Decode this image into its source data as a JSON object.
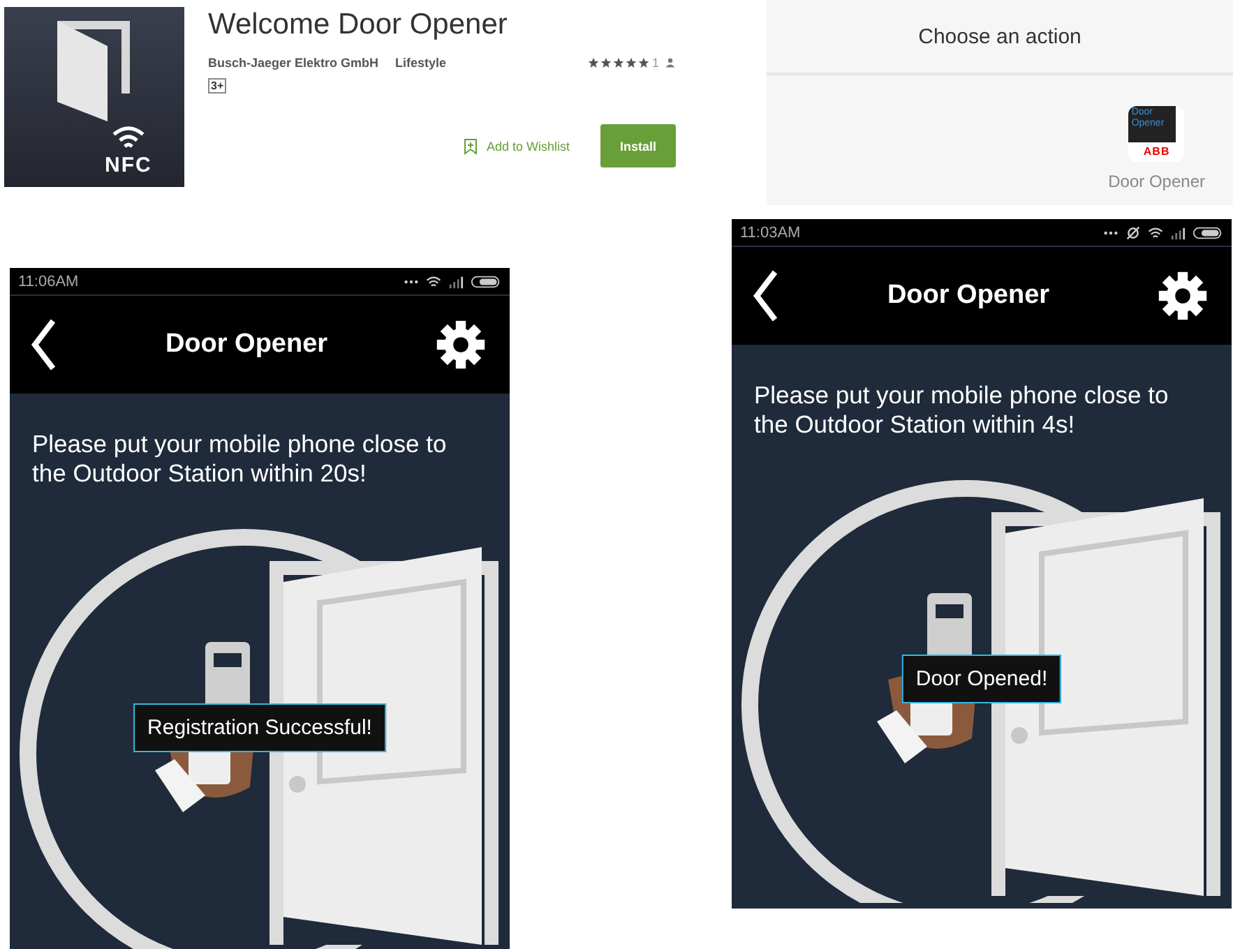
{
  "store_listing": {
    "icon_label": "NFC",
    "title": "Welcome Door Opener",
    "developer": "Busch-Jaeger Elektro GmbH",
    "category": "Lifestyle",
    "stars": 5,
    "rating_count": "1",
    "content_rating": "3+",
    "wishlist": "Add to Wishlist",
    "install": "Install"
  },
  "chooser": {
    "title": "Choose an action",
    "app_icon_text": "Door Opener",
    "app_icon_brand": "ABB",
    "app_label": "Door Opener"
  },
  "phones": [
    {
      "time": "11:06AM",
      "sync_icon": false,
      "title": "Door Opener",
      "message": "Please put your mobile phone close to the Outdoor Station within 20s!",
      "toast": "Registration Successful!"
    },
    {
      "time": "11:03AM",
      "sync_icon": true,
      "title": "Door Opener",
      "message": "Please put your mobile phone close to the Outdoor Station within 4s!",
      "toast": "Door Opened!"
    }
  ]
}
